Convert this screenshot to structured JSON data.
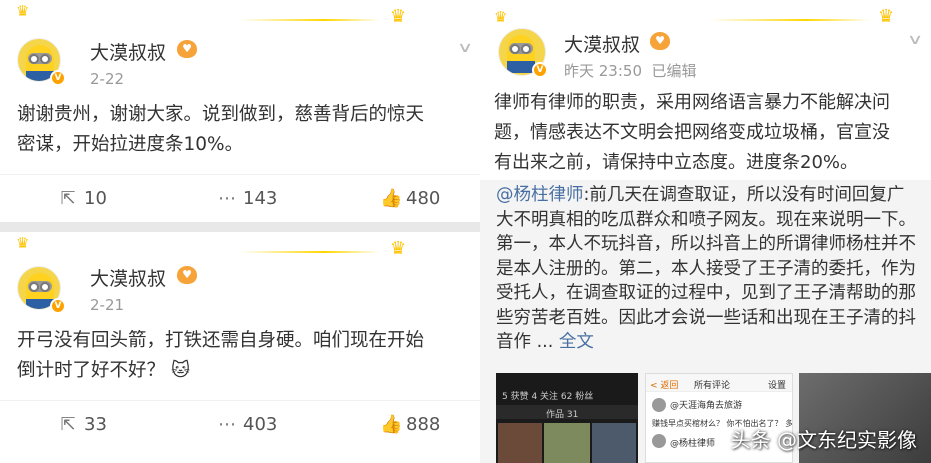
{
  "posts": [
    {
      "username": "大漠叔叔",
      "date": "2-22",
      "text_lines": [
        "谢谢贵州，谢谢大家。说到做到，慈善背后的惊天",
        "密谋，开始拉进度条10%。"
      ],
      "reposts": "10",
      "comments": "143",
      "likes": "480"
    },
    {
      "username": "大漠叔叔",
      "date": "2-21",
      "text_lines": [
        "开弓没有回头箭，打铁还需自身硬。咱们现在开始",
        "倒计时了好不好？"
      ],
      "emoji": "🐱",
      "reposts": "33",
      "comments": "403",
      "likes": "888"
    },
    {
      "username": "大漠叔叔",
      "date": "昨天 23:50",
      "edited": "已编辑",
      "text_lines": [
        "律师有律师的职责，采用网络语言暴力不能解决问",
        "题，情感表达不文明会把网络变成垃圾桶，官宣没",
        "有出来之前，请保持中立态度。进度条20%。"
      ],
      "repost": {
        "mention": "@杨柱律师",
        "lines": [
          ":前几天在调查取证，所以没有时间回复广",
          "大不明真相的吃瓜群众和喷子网友。现在来说明一下。",
          "第一，本人不玩抖音，所以抖音上的所谓律师杨柱并不",
          "是本人注册的。第二，本人接受了王子清的委托，作为",
          "受托人，在调查取证的过程中，见到了王子清帮助的那",
          "些穷苦老百姓。因此才会说一些话和出现在王子清的抖",
          "音作 ..."
        ],
        "full_text_link": "全文"
      }
    }
  ],
  "thumbs": {
    "t1_stats": "5 获赞    4 关注    62 粉丝",
    "t1_tabs": "作品 31",
    "t2_back": "< 返回",
    "t2_title": "所有评论",
    "t2_settings": "设置",
    "t2_user": "@天涯海角去旅游",
    "t2_comment": "赚钱早点买棺材么？ 你不怕出名了？ 多来点人举报他！",
    "t2_reply": "@杨柱律师"
  },
  "watermark": "头条 @文东纪实影像",
  "colors": {
    "link": "#496fa2",
    "vip": "#f6a43a",
    "crown": "#ffc300"
  }
}
